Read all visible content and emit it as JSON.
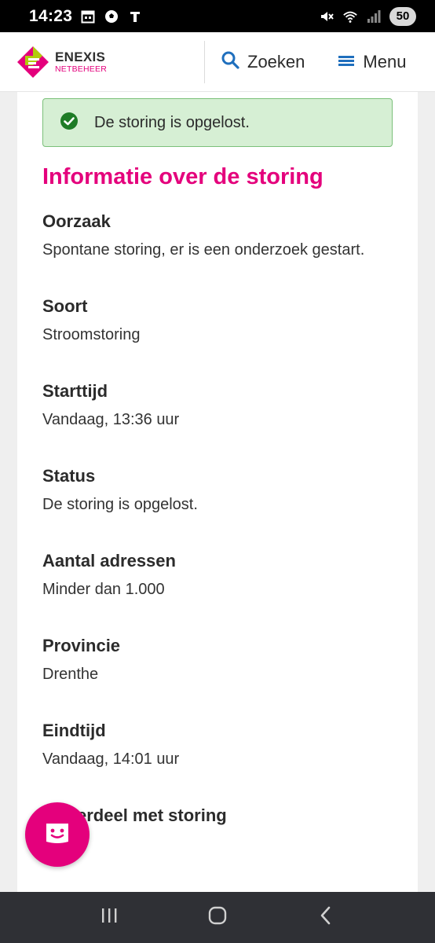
{
  "status_bar": {
    "time": "14:23",
    "battery": "50",
    "icons": [
      "calendar-icon",
      "soccer-ball-icon",
      "telegraaf-icon",
      "mute-icon",
      "wifi-icon",
      "signal-icon"
    ]
  },
  "header": {
    "logo_name": "ENEXIS",
    "logo_sub": "NETBEHEER",
    "search_label": "Zoeken",
    "menu_label": "Menu"
  },
  "alert": {
    "text": "De storing is opgelost."
  },
  "section": {
    "title": "Informatie over de storing"
  },
  "fields": [
    {
      "label": "Oorzaak",
      "value": "Spontane storing, er is een onderzoek gestart."
    },
    {
      "label": "Soort",
      "value": "Stroomstoring"
    },
    {
      "label": "Starttijd",
      "value": "Vandaag, 13:36 uur"
    },
    {
      "label": "Status",
      "value": "De storing is opgelost."
    },
    {
      "label": "Aantal adressen",
      "value": "Minder dan 1.000"
    },
    {
      "label": "Provincie",
      "value": "Drenthe"
    },
    {
      "label": "Eindtijd",
      "value": "Vandaag, 14:01 uur"
    },
    {
      "label": "Onderdeel met storing",
      "value": ""
    }
  ],
  "colors": {
    "brand_magenta": "#e4007c",
    "brand_lime": "#b2cb0b",
    "alert_bg": "#d6efd4",
    "alert_border": "#7bc07a",
    "check_green": "#1e7c26",
    "link_blue": "#1f6fbd"
  }
}
